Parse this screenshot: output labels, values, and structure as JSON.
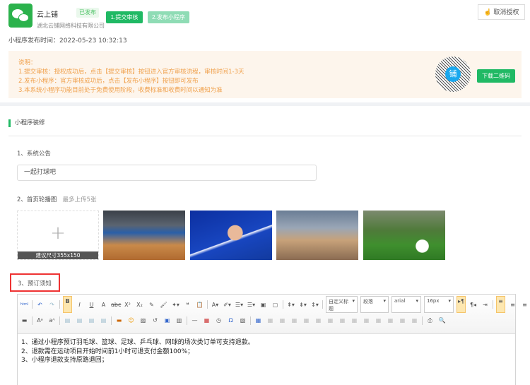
{
  "app": {
    "name": "云上铺",
    "status": "已发布",
    "company": "湖北云铺网络科技有限公司",
    "logo_icon": "wechat-icon"
  },
  "actions": {
    "submit": "1.提交审核",
    "publish": "2.发布小程序",
    "cancel_auth": "取消授权",
    "download_qr": "下载二维码"
  },
  "publish_time": "小程序发布时间：2022-05-23 10:32:13",
  "notice": {
    "title": "说明：",
    "lines": [
      "1.提交审核：授权成功后，点击【提交审核】按钮进入官方审核流程，审核时间1-3天",
      "2.发布小程序：官方审核成功后，点击【发布小程序】按钮即可发布",
      "3.本系统小程序功能目前处于免费使用阶段，收费标准和收费时间以通知为准"
    ],
    "qr_char": "铺"
  },
  "section": {
    "title": "小程序装修"
  },
  "announcement": {
    "label": "1、系统公告",
    "value": "一起打球吧"
  },
  "carousel": {
    "label": "2、首页轮播图",
    "hint": "最多上传5张",
    "upload_hint": "建议尺寸355x150"
  },
  "booking": {
    "label": "3、预订须知",
    "toolbar": {
      "heading": "自定义标题",
      "paragraph": "段落",
      "font": "arial",
      "size": "16px"
    },
    "content": [
      "1、通过小程序预订羽毛球、篮球、足球、乒乓球、网球的场次类订单可支持退款。",
      "2、退款需在运动项目开始时间前1小时可退支付金额100%；",
      "3、小程序退款支持原路退回；"
    ]
  },
  "colors": {
    "accent": "#20b964",
    "notice_text": "#f0a04b",
    "highlight": "#e33333"
  }
}
